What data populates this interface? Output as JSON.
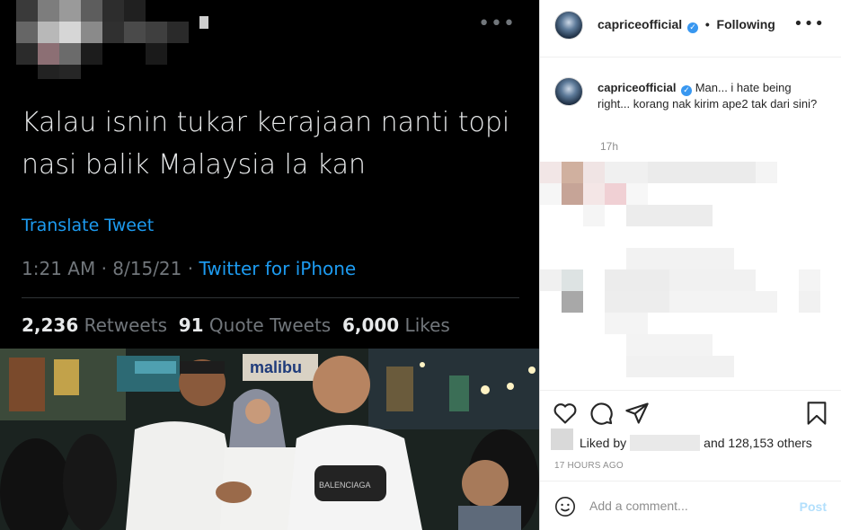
{
  "tweet": {
    "more_icon": "ellipsis-icon",
    "text": "Kalau isnin tukar kerajaan nanti topi nasi balik Malaysia la kan",
    "translate": "Translate Tweet",
    "time": "1:21 AM · 8/15/21 · ",
    "source": "Twitter for iPhone",
    "retweets_count": "2,236",
    "retweets_label": " Retweets  ",
    "quote_count": "91",
    "quote_label": " Quote Tweets  ",
    "likes_count": "6,000",
    "likes_label": " Likes"
  },
  "photo": {
    "sign_text": "malibu",
    "bag_text": "BALENCIAGA"
  },
  "post": {
    "username": "capriceofficial",
    "following": "Following",
    "dot": " • ",
    "caption": "Man... i hate being right... korang nak kirim ape2 tak dari sini?",
    "caption_time": "17h",
    "liked_by": "Liked by",
    "and_others": "and 128,153 others",
    "time_ago": "17 HOURS AGO",
    "comment_placeholder": "Add a comment...",
    "post_label": "Post"
  },
  "colors": {
    "twitter_blue": "#1d9bf0",
    "ig_verified": "#3897f0",
    "ig_post_disabled": "#b2dffc"
  }
}
